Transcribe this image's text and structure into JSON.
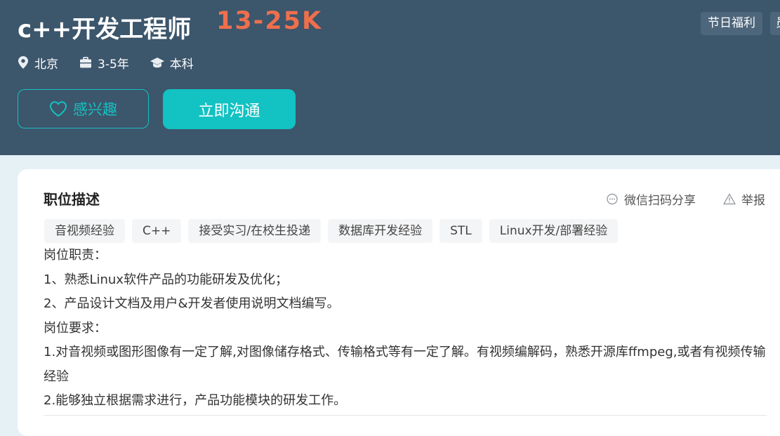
{
  "job": {
    "title": "c++开发工程师",
    "salary": "13-25K",
    "benefit_tags": [
      "节日福利",
      "员工旅游"
    ]
  },
  "meta": {
    "location": "北京",
    "experience": "3-5年",
    "education": "本科"
  },
  "buttons": {
    "interest_label": "感兴趣",
    "chat_label": "立即沟通"
  },
  "description": {
    "title": "职位描述",
    "share_label": "微信扫码分享",
    "report_label": "举报",
    "skill_tags": [
      "音视频经验",
      "C++",
      "接受实习/在校生投递",
      "数据库开发经验",
      "STL",
      "Linux开发/部署经验"
    ],
    "lines": [
      "岗位职责：",
      "1、熟悉Linux软件产品的功能研发及优化；",
      "2、产品设计文档及用户&开发者使用说明文档编写。",
      "岗位要求：",
      "1.对音视频或图形图像有一定了解,对图像储存格式、传输格式等有一定了解。有视频编解码，熟悉开源库ffmpeg,或者有视频传输经验",
      "2.能够独立根据需求进行，产品功能模块的研发工作。"
    ]
  },
  "colors": {
    "header_bg": "#3c566c",
    "salary": "#ef6f4d",
    "accent": "#13c2c2"
  }
}
